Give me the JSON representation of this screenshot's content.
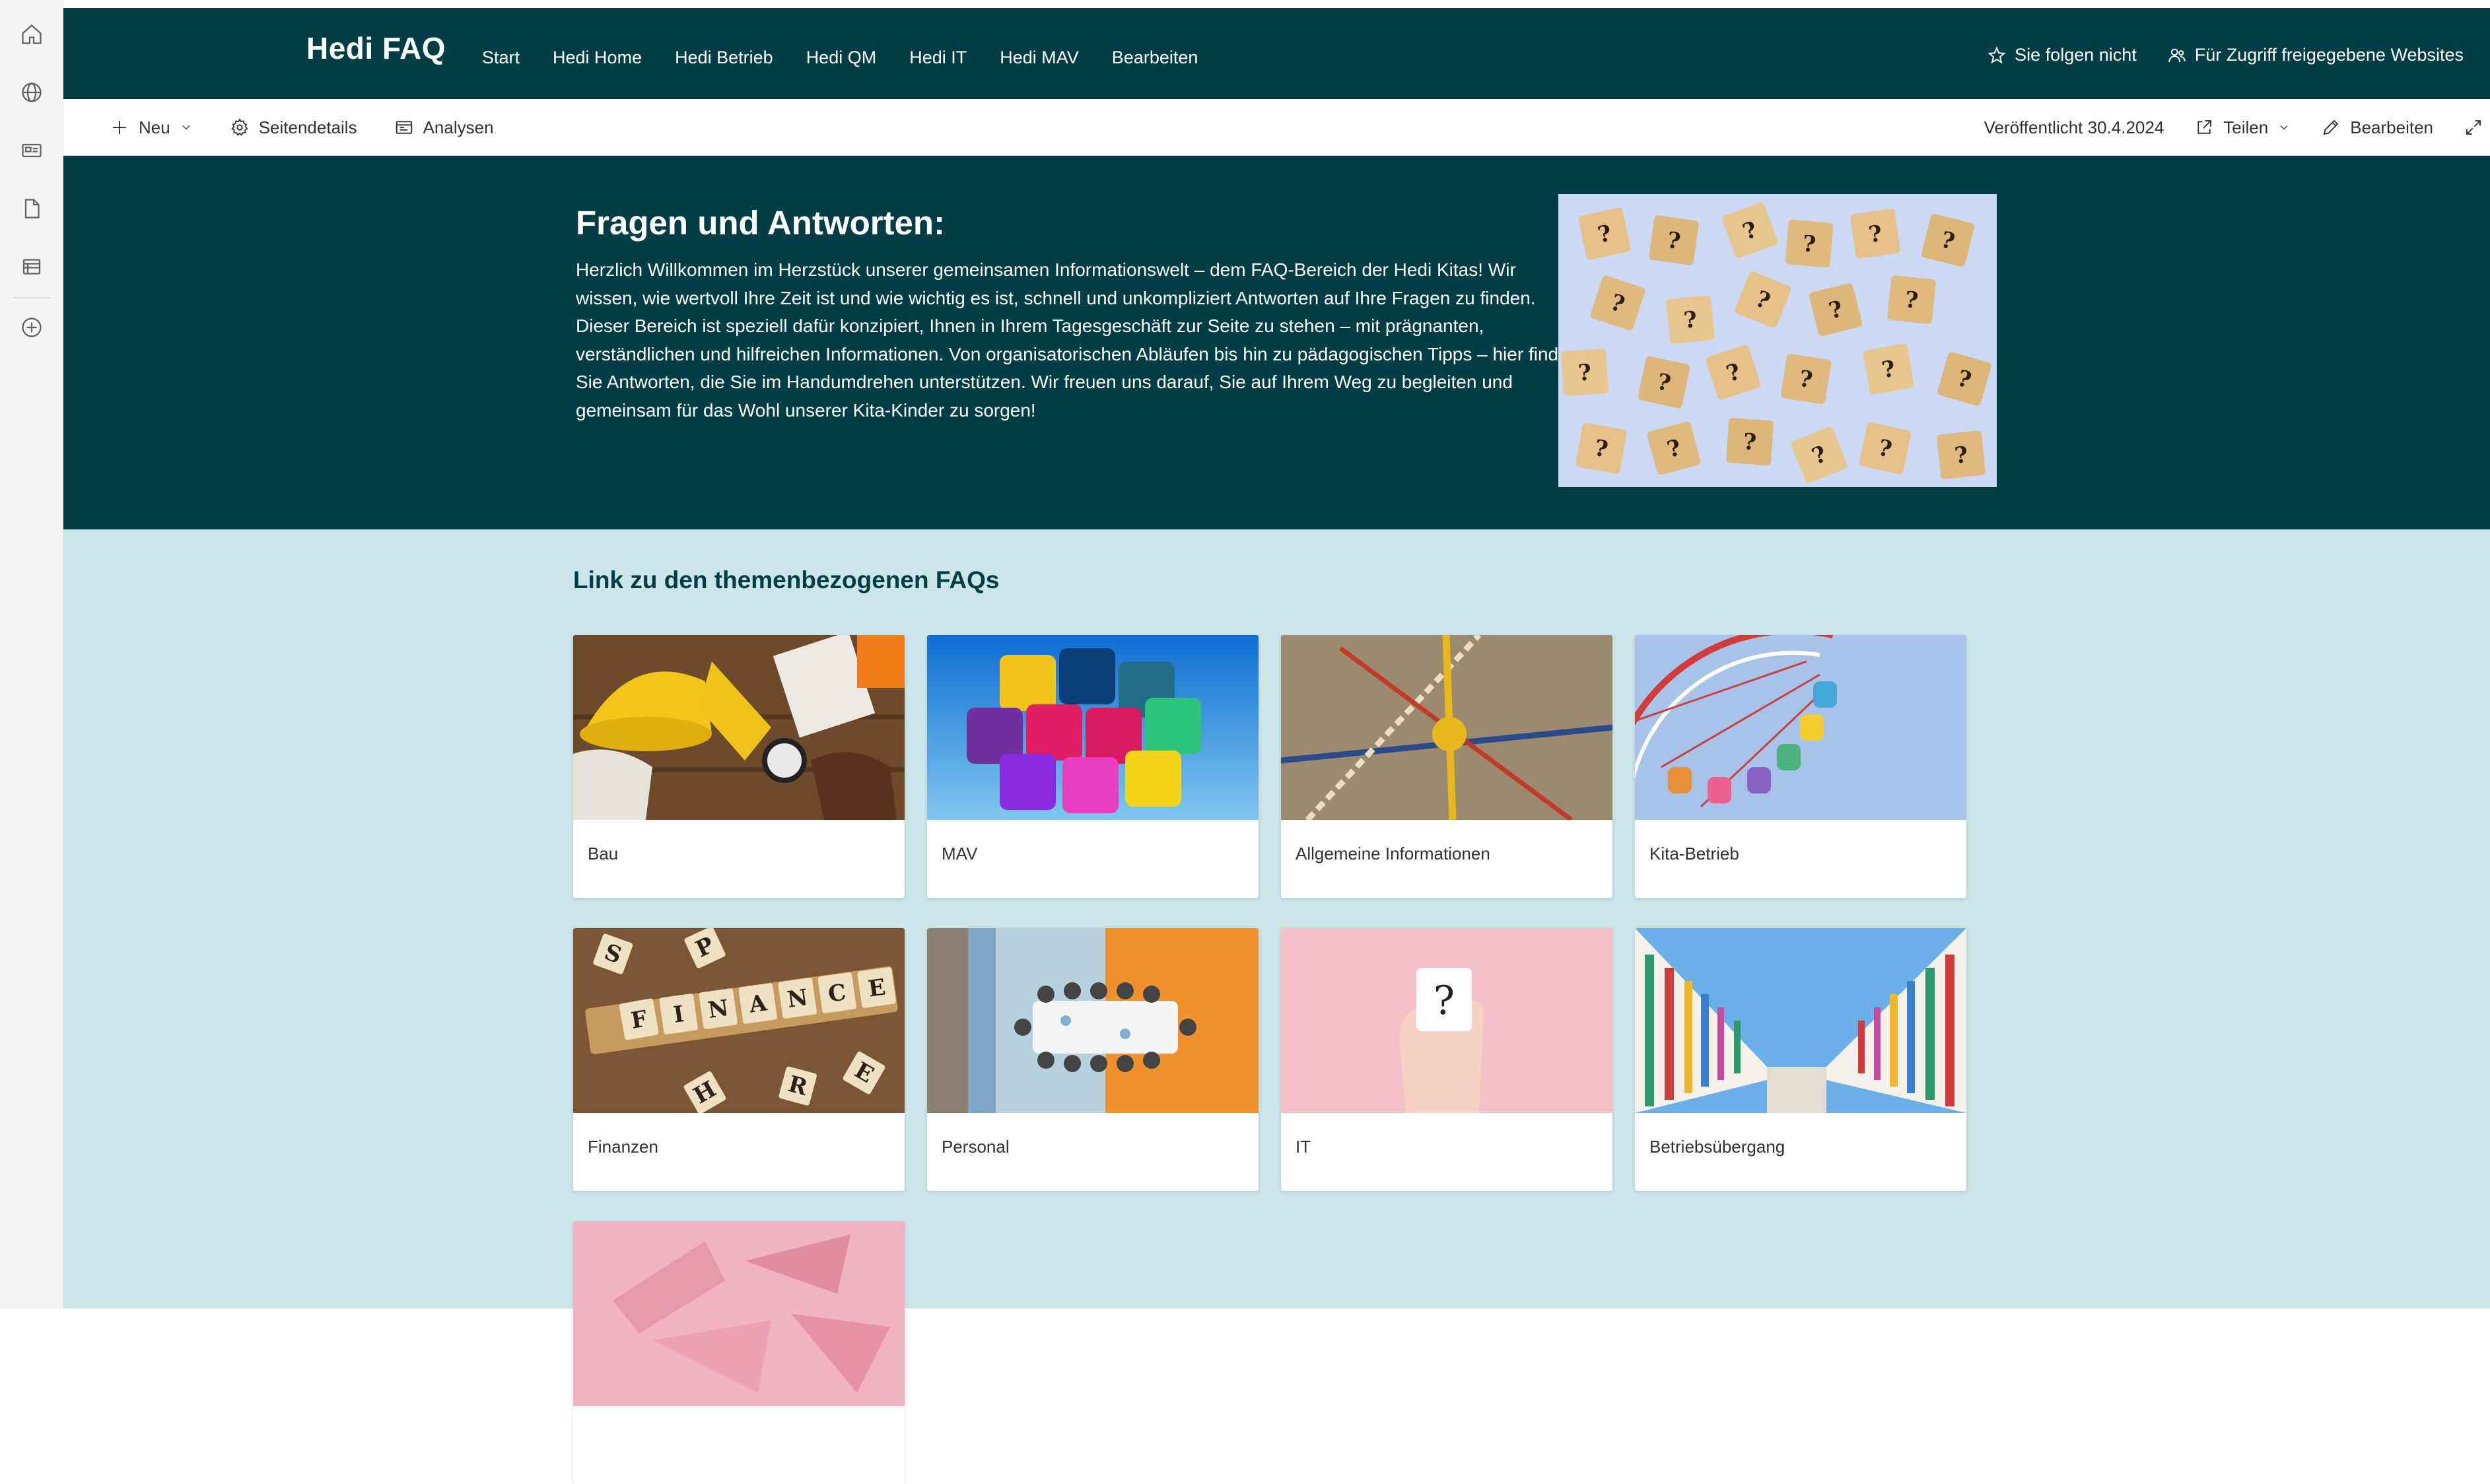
{
  "site": {
    "title": "Hedi FAQ",
    "nav": [
      "Start",
      "Hedi Home",
      "Hedi Betrieb",
      "Hedi QM",
      "Hedi IT",
      "Hedi MAV",
      "Bearbeiten"
    ],
    "follow_label": "Sie folgen nicht",
    "shared_label": "Für Zugriff freigegebene Websites"
  },
  "commandbar": {
    "new_label": "Neu",
    "page_details_label": "Seitendetails",
    "analytics_label": "Analysen",
    "published_label": "Veröffentlicht 30.4.2024",
    "share_label": "Teilen",
    "edit_label": "Bearbeiten"
  },
  "hero": {
    "title": "Fragen und Antworten:",
    "text": "Herzlich Willkommen im Herzstück unserer gemeinsamen Informationswelt – dem FAQ-Bereich der Hedi Kitas! Wir wissen, wie wertvoll Ihre Zeit ist und wie wichtig es ist, schnell und unkompliziert Antworten auf Ihre Fragen zu finden. Dieser Bereich ist speziell dafür konzipiert, Ihnen in Ihrem Tagesgeschäft zur Seite zu stehen – mit prägnanten, verständlichen und hilfreichen Informationen. Von organisatorischen Abläufen bis hin zu pädagogischen Tipps – hier finden Sie Antworten, die Sie im Handumdrehen unterstützen. Wir freuen uns darauf, Sie auf Ihrem Weg zu begleiten und gemeinsam für das Wohl unserer Kita-Kinder zu sorgen!"
  },
  "links": {
    "title": "Link zu den themenbezogenen FAQs",
    "cards": [
      {
        "label": "Bau"
      },
      {
        "label": "MAV"
      },
      {
        "label": "Allgemeine Informationen"
      },
      {
        "label": "Kita-Betrieb"
      },
      {
        "label": "Finanzen"
      },
      {
        "label": "Personal"
      },
      {
        "label": "IT"
      },
      {
        "label": "Betriebsübergang"
      },
      {
        "label": ""
      }
    ]
  },
  "colors": {
    "theme_dark": "#003d44",
    "section_bg": "#cce5e8"
  },
  "icons": [
    "home-icon",
    "globe-icon",
    "news-icon",
    "document-icon",
    "list-icon",
    "add-icon",
    "star-icon",
    "people-icon",
    "plus-icon",
    "gear-icon",
    "analytics-icon",
    "share-icon",
    "pencil-icon",
    "expand-icon"
  ]
}
